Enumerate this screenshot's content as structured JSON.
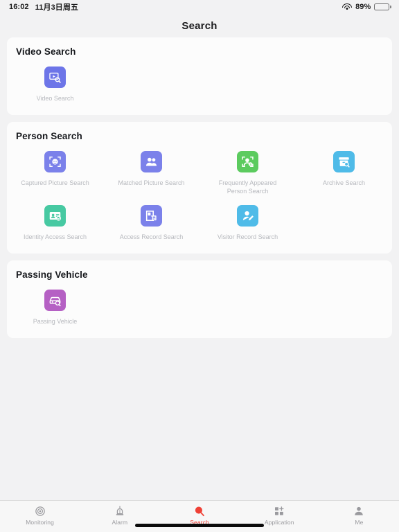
{
  "statusbar": {
    "time": "16:02",
    "date": "11月3日周五",
    "battery_percent": "89%",
    "wifi_icon": "wifi-icon",
    "battery_icon": "battery-icon"
  },
  "navbar": {
    "title": "Search"
  },
  "sections": [
    {
      "title": "Video Search",
      "items": [
        {
          "label": "Video Search",
          "icon": "video-search-icon",
          "color": "#6d75e8"
        }
      ]
    },
    {
      "title": "Person Search",
      "items": [
        {
          "label": "Captured Picture Search",
          "icon": "face-capture-icon",
          "color": "#7b81ea"
        },
        {
          "label": "Matched Picture Search",
          "icon": "people-icon",
          "color": "#7b81ea"
        },
        {
          "label": "Frequently Appeared Person Search",
          "icon": "frequent-person-icon",
          "color": "#5ccb5f"
        },
        {
          "label": "Archive Search",
          "icon": "archive-icon",
          "color": "#4fbbe8"
        },
        {
          "label": "Identity Access Search",
          "icon": "id-card-check-icon",
          "color": "#47c9a2"
        },
        {
          "label": "Access Record Search",
          "icon": "door-access-icon",
          "color": "#7b81ea"
        },
        {
          "label": "Visitor Record Search",
          "icon": "visitor-pen-icon",
          "color": "#4fbbe8"
        }
      ]
    },
    {
      "title": "Passing Vehicle",
      "items": [
        {
          "label": "Passing Vehicle",
          "icon": "car-search-icon",
          "color": "#b560c4"
        }
      ]
    }
  ],
  "tabbar": {
    "active_color": "#ef4136",
    "inactive_color": "#9a9a9e",
    "tabs": [
      {
        "label": "Monitoring",
        "icon": "monitoring-icon",
        "active": false
      },
      {
        "label": "Alarm",
        "icon": "alarm-siren-icon",
        "active": false
      },
      {
        "label": "Search",
        "icon": "search-magnifier-icon",
        "active": true
      },
      {
        "label": "Application",
        "icon": "application-grid-icon",
        "active": false
      },
      {
        "label": "Me",
        "icon": "me-person-icon",
        "active": false
      }
    ]
  }
}
